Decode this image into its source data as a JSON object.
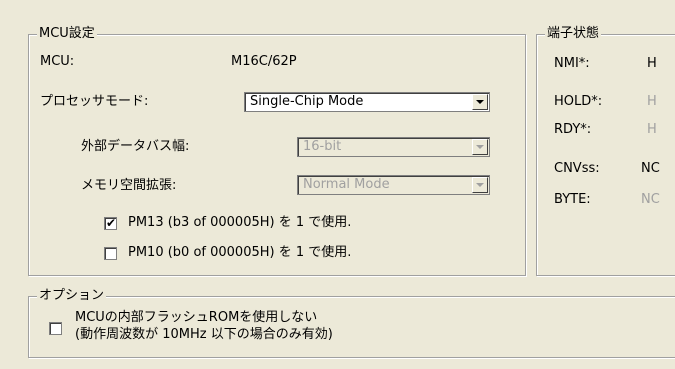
{
  "mcu_group": {
    "title": "MCU設定",
    "mcu_label": "MCU:",
    "mcu_value": "M16C/62P",
    "mode_label": "プロセッサモード:",
    "mode_value": "Single-Chip Mode",
    "bus_label": "外部データバス幅:",
    "bus_value": "16-bit",
    "mem_label": "メモリ空間拡張:",
    "mem_value": "Normal Mode",
    "pm13_label": "PM13 (b3 of 000005H) を 1 で使用.",
    "pm13_checked": true,
    "pm10_label": "PM10 (b0 of 000005H) を 1 で使用.",
    "pm10_checked": false
  },
  "pin_group": {
    "title": "端子状態",
    "pins": [
      {
        "name": "NMI*:",
        "value": "H"
      },
      {
        "name": "HOLD*:",
        "value": "H"
      },
      {
        "name": "RDY*:",
        "value": "H"
      },
      {
        "name": "CNVss:",
        "value": "NC"
      },
      {
        "name": "BYTE:",
        "value": "NC"
      }
    ]
  },
  "option_group": {
    "title": "オプション",
    "flash_line1": "MCUの内部フラッシュROMを使用しない",
    "flash_line2": "(動作周波数が 10MHz 以下の場合のみ有効)",
    "flash_checked": false
  }
}
